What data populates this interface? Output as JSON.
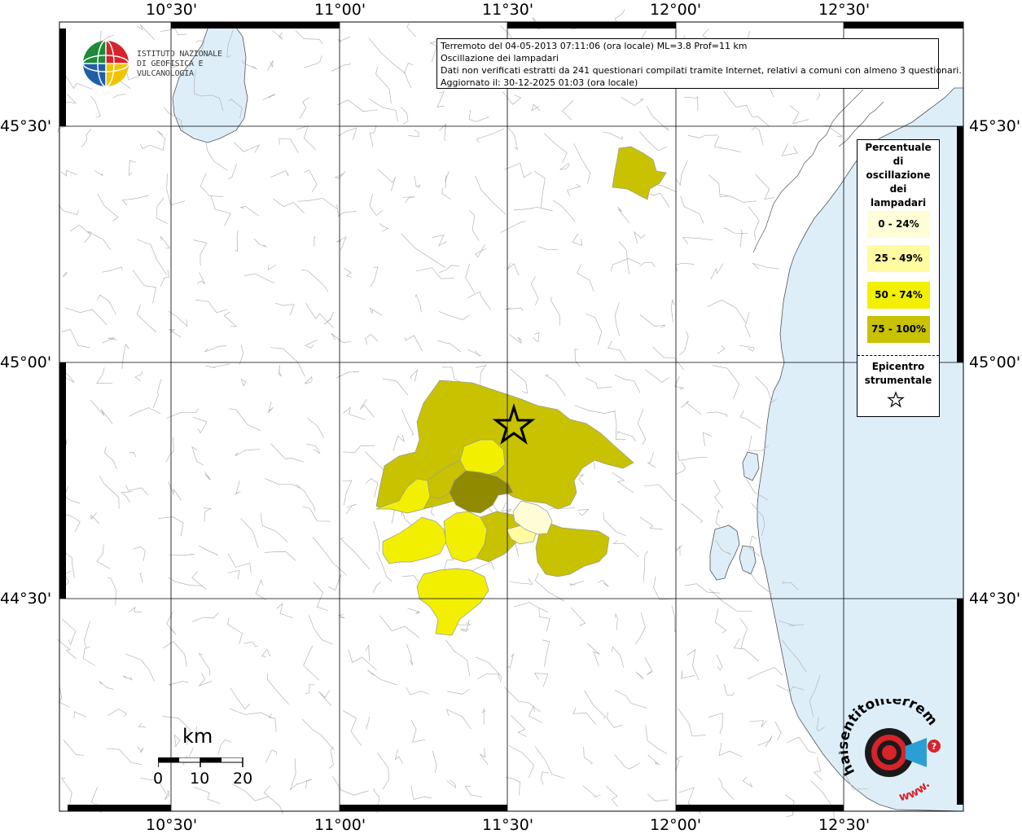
{
  "map": {
    "lon_labels": [
      "10°30'",
      "11°00'",
      "11°30'",
      "12°00'",
      "12°30'"
    ],
    "lat_labels": [
      "45°30'",
      "45°00'",
      "44°30'"
    ],
    "epicenter": {
      "lon": 11.52,
      "lat": 44.87
    }
  },
  "info": {
    "line1": "Terremoto del 04-05-2013 07:11:06 (ora locale) ML=3.8 Prof=11 km",
    "line2": "Oscillazione dei lampadari",
    "line3": "Dati non verificati estratti da 241 questionari compilati tramite Internet, relativi a comuni con almeno 3 questionari.",
    "line4": "Aggiornato il: 30-12-2025 01:03 (ora locale)"
  },
  "logo": {
    "line1": "ISTITUTO NAZIONALE",
    "line2": "DI GEOFISICA E VULCANOLOGIA"
  },
  "legend": {
    "title_lines": [
      "Percentuale",
      "di",
      "oscillazione",
      "dei",
      "lampadari"
    ],
    "classes": [
      {
        "label": "0 - 24%",
        "color": "#fefdd6"
      },
      {
        "label": "25 - 49%",
        "color": "#fefba0"
      },
      {
        "label": "50 - 74%",
        "color": "#f2f000"
      },
      {
        "label": "75 - 100%",
        "color": "#c8c200"
      }
    ],
    "epicenter_lines": [
      "Epicentro",
      "strumentale"
    ]
  },
  "scale": {
    "unit": "km",
    "labels": [
      "0",
      "10",
      "20"
    ]
  },
  "brand": {
    "text": "haisentitoilterremoto.it",
    "text2": "www."
  },
  "colors": {
    "sea": "#ddeef9",
    "land": "#ffffff",
    "border": "#b4b4b4",
    "grid": "#000000",
    "class_0": "#fefdd6",
    "class_1": "#fefba0",
    "class_2": "#f2f000",
    "class_3": "#c8c200",
    "class_dark": "#8f8a00",
    "brand_red": "#d8232a"
  }
}
